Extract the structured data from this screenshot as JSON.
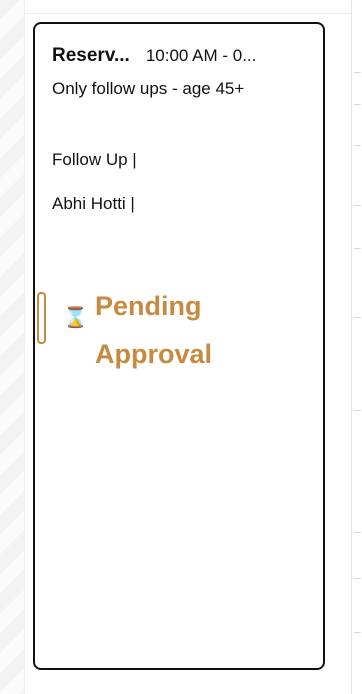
{
  "appointment": {
    "title": "Reserv...",
    "time": "10:00 AM - 0...",
    "subtitle": "Only follow ups - age 45+",
    "detail_1": "Follow Up |",
    "detail_2": "Abhi Hotti |",
    "status": {
      "line_1": "Pending",
      "line_2": "Approval",
      "icon": "hourglass-icon",
      "color": "#c78a3f"
    }
  },
  "colors": {
    "text": "#111111",
    "border": "#111111",
    "status": "#c78a3f"
  }
}
